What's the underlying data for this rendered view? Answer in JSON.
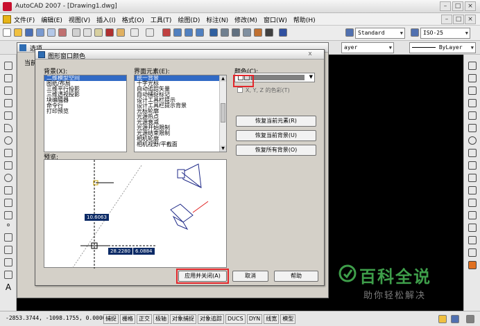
{
  "window": {
    "title": "AutoCAD 2007 - [Drawing1.dwg]"
  },
  "menu": [
    "文件(F)",
    "编辑(E)",
    "视图(V)",
    "插入(I)",
    "格式(O)",
    "工具(T)",
    "绘图(D)",
    "标注(N)",
    "修改(M)",
    "窗口(W)",
    "帮助(H)"
  ],
  "toolbar": {
    "text_style": "Standard",
    "dim_style": "ISO-25",
    "layer_right": "ByLayer",
    "layer_left": "ayer"
  },
  "options_dialog": {
    "title": "选项",
    "current_label": "当前"
  },
  "dialog": {
    "title": "图形窗口颜色",
    "close": "x",
    "background_label": "背景(X):",
    "background_items": [
      "二维模型空间",
      "图纸/布局",
      "三维平行投影",
      "三维透视投影",
      "块编辑器",
      "命令行",
      "打印预览"
    ],
    "background_selected": 0,
    "element_label": "界面元素(E):",
    "element_items": [
      "统一背景",
      "十字光标",
      "自动追踪矢量",
      "自动捕捉标记",
      "设计工具栏提示",
      "设计工具栏提示背景",
      "光标轮廓",
      "光源热点",
      "光源衰减",
      "光源开始限制",
      "光源结束限制",
      "相机轮廓",
      "相机视野/平截面"
    ],
    "element_selected": 0,
    "color_label": "颜色(C):",
    "tint_label": "X, Y, Z 的色彩(T)",
    "restore_element": "恢复当前元素(R)",
    "restore_context": "恢复当前背景(U)",
    "restore_all": "恢复所有背景(O)",
    "preview_label": "预览:",
    "preview_value1": "10.6063",
    "preview_value2": "28.2280",
    "preview_value3": "6.0884",
    "apply_close": "应用并关闭(A)",
    "cancel": "取消",
    "help": "帮助"
  },
  "status": {
    "coords": "-2853.3744, -1098.1755, 0.0000",
    "buttons": [
      "捕捉",
      "栅格",
      "正交",
      "极轴",
      "对象捕捉",
      "对象追踪",
      "DUCS",
      "DYN",
      "线宽",
      "模型"
    ]
  },
  "watermark": {
    "title": "百科全说",
    "subtitle": "助你轻松解决"
  },
  "colors": {
    "accent": "#316ac5",
    "highlight": "#e4262b",
    "watermark_green": "#3e9e4a"
  }
}
